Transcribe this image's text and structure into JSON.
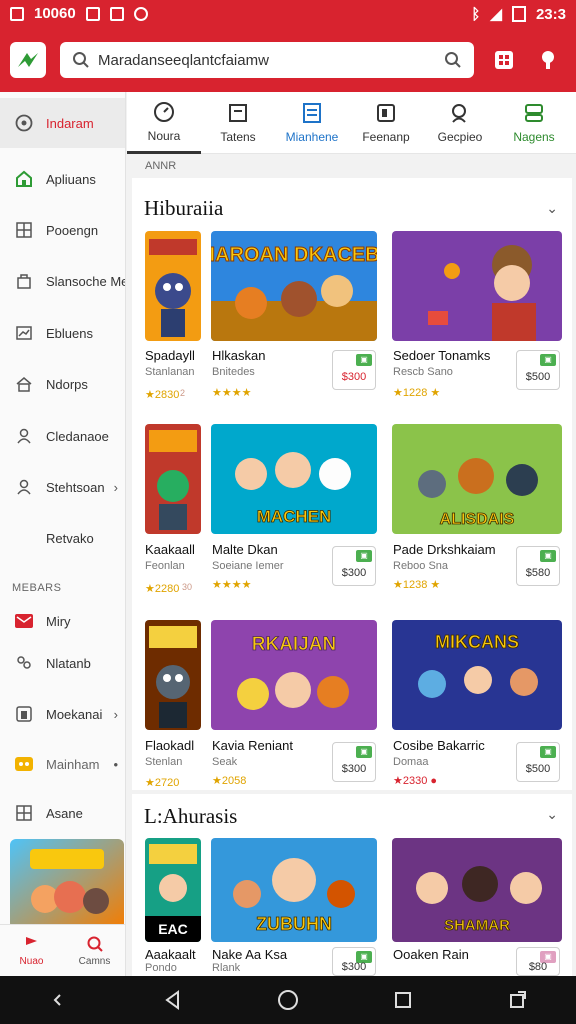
{
  "status_bar": {
    "time_left": "10060",
    "time_right": "23:3"
  },
  "search": {
    "value": "Maradanseeqlantcfaiamw"
  },
  "sidebar": {
    "items": [
      {
        "label": "Indaram",
        "icon": "compass-icon"
      },
      {
        "label": "Apliuans",
        "icon": "home-icon"
      },
      {
        "label": "Pooengn",
        "icon": "grid-icon"
      },
      {
        "label": "Slansoche Me",
        "icon": "bag-icon"
      },
      {
        "label": "Ebluens",
        "icon": "chart-icon"
      },
      {
        "label": "Ndorps",
        "icon": "house-icon"
      },
      {
        "label": "Cledanaoe",
        "icon": "person-icon"
      },
      {
        "label": "Stehtsoan",
        "icon": "user-icon"
      },
      {
        "label": "Retvako",
        "icon": ""
      }
    ],
    "section_label": "MEBARS",
    "items2": [
      {
        "label": "Miry",
        "icon": "mail-icon"
      },
      {
        "label": "Nlatanb",
        "icon": "people-icon"
      },
      {
        "label": "Moekanai",
        "icon": "box-icon"
      },
      {
        "label": "Mainham",
        "icon": "controller-icon"
      },
      {
        "label": "Asane",
        "icon": "grid-icon"
      }
    ],
    "bottom_tabs": [
      {
        "label": "Nuao"
      },
      {
        "label": "Camns"
      }
    ]
  },
  "tabs": [
    {
      "label": "Noura",
      "icon": "clock-icon"
    },
    {
      "label": "Tatens",
      "icon": "tablet-icon"
    },
    {
      "label": "Mianhene",
      "icon": "list-icon"
    },
    {
      "label": "Feenanp",
      "icon": "book-icon"
    },
    {
      "label": "Gecpieo",
      "icon": "search-icon"
    },
    {
      "label": "Nagens",
      "icon": "app-icon"
    }
  ],
  "breadcrumb": "ANNR",
  "sections": [
    {
      "title": "Hiburaiia",
      "cards": [
        {
          "name": "Spadayll",
          "sub": "Stanlanan",
          "rating": "★2830",
          "tag": "2",
          "price": ""
        },
        {
          "name": "Hlkaskan",
          "sub": "Bnitedes",
          "rating": "★★★★",
          "tag": "",
          "price": "$300",
          "price_red": true,
          "thumb_text": "KIAROAN DKACEBE"
        },
        {
          "name": "Sedoer Tonamks",
          "sub": "Rescb Sano",
          "rating": "★1228 ★",
          "tag": "",
          "price": "$500"
        }
      ]
    },
    {
      "title": "",
      "cards": [
        {
          "name": "Kaakaall",
          "sub": "Feonlan",
          "rating": "★2280",
          "tag": "30",
          "price": ""
        },
        {
          "name": "Malte Dkan",
          "sub": "Soeiane Iemer",
          "rating": "★★★★",
          "tag": "",
          "price": "$300",
          "thumb_text": "MACHEN"
        },
        {
          "name": "Pade Drkshkaiam",
          "sub": "Reboo Sna",
          "rating": "★1238 ★",
          "tag": "",
          "price": "$580",
          "thumb_text": "ALISDAIS"
        }
      ]
    },
    {
      "title": "",
      "cards": [
        {
          "name": "Flaokadl",
          "sub": "Stenlan",
          "rating": "★2720",
          "tag": "",
          "price": ""
        },
        {
          "name": "Kavia Reniant",
          "sub": "Seak",
          "rating": "★2058",
          "tag": "",
          "price": "$300",
          "thumb_text": "RKAIJAN"
        },
        {
          "name": "Cosibe Bakarric",
          "sub": "Domaa",
          "rating": "★2330 ●",
          "tag": "",
          "price": "$500",
          "thumb_text": "MIKCANS"
        }
      ]
    },
    {
      "title": "L:Ahurasis",
      "cards": [
        {
          "name": "Aaakaalt",
          "sub": "Pondo",
          "rating": "",
          "tag": "",
          "price": "",
          "thumb_text": "EAC"
        },
        {
          "name": "Nake Aa Ksa",
          "sub": "Rlank",
          "rating": "",
          "tag": "",
          "price": "$300",
          "thumb_text": "ZUBUHN"
        },
        {
          "name": "Ooaken Rain",
          "sub": "",
          "rating": "",
          "tag": "",
          "price": "$80",
          "thumb_text": "SHAMAR"
        }
      ]
    }
  ],
  "colors": {
    "brand": "#d8232f",
    "blue": "#1e73c8",
    "green": "#2e8b2e"
  }
}
